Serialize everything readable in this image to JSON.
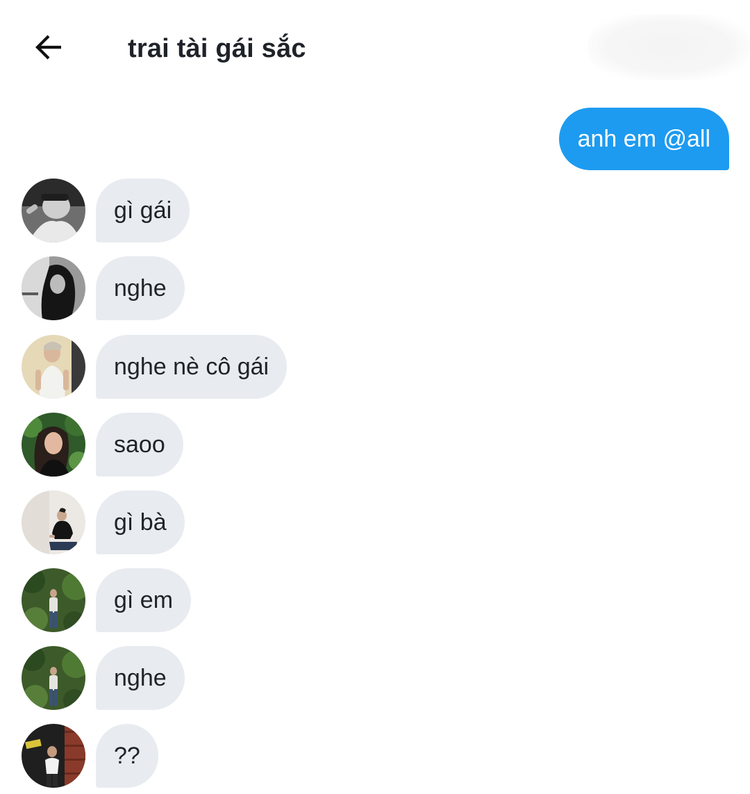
{
  "header": {
    "title": "trai tài gái sắc",
    "back_icon": "arrow-left-icon"
  },
  "outgoing": {
    "text": "anh em @all",
    "color": "#1d9bf0"
  },
  "messages": [
    {
      "text": "gì gái"
    },
    {
      "text": "nghe"
    },
    {
      "text": "nghe nè cô gái"
    },
    {
      "text": "saoo"
    },
    {
      "text": "gì bà"
    },
    {
      "text": "gì em"
    },
    {
      "text": "nghe"
    },
    {
      "text": "??"
    }
  ],
  "colors": {
    "incoming_bubble": "#e8ecf0",
    "text": "#1f2329"
  }
}
